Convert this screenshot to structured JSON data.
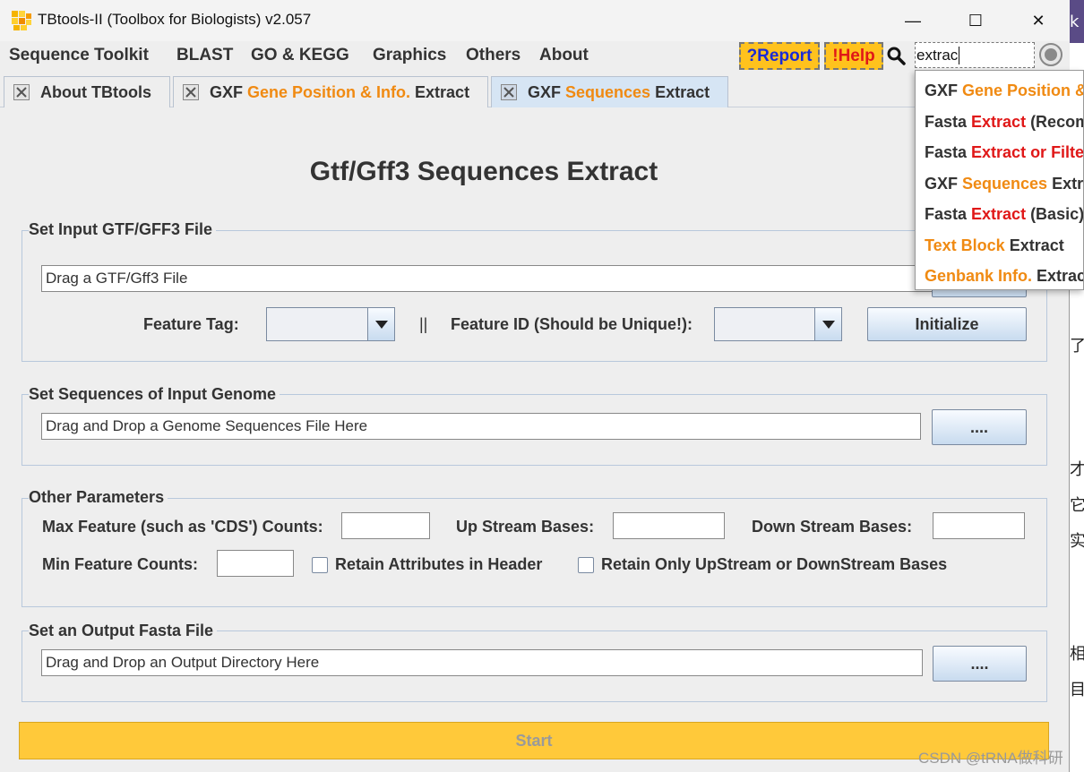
{
  "window": {
    "title": "TBtools-II (Toolbox for Biologists) v2.057",
    "minimize": "—",
    "maximize": "☐",
    "close": "✕"
  },
  "menu": {
    "items": [
      "Sequence Toolkit",
      "BLAST",
      "GO & KEGG",
      "Graphics",
      "Others",
      "About"
    ],
    "report_label": "?Report",
    "help_label": "!Help",
    "search_value": "extrac"
  },
  "tabs": [
    {
      "label_plain": "About TBtools"
    },
    {
      "label_a": "GXF ",
      "label_b": "Gene Position & Info.",
      "label_c": " Extract"
    },
    {
      "label_a": "GXF ",
      "label_b": "Sequences",
      "label_c": " Extract"
    }
  ],
  "dropdown": [
    {
      "a": "GXF ",
      "b": "Gene Position &",
      "c": ""
    },
    {
      "a": "Fasta ",
      "b": "Extract",
      "c": " (Recom"
    },
    {
      "a": "Fasta ",
      "b": "Extract or Filte",
      "c": ""
    },
    {
      "a": "GXF ",
      "b": "Sequences",
      "c": " Extr"
    },
    {
      "a": "Fasta ",
      "b": "Extract",
      "c": " (Basic)"
    },
    {
      "a": "",
      "b": "Text Block",
      "c": " Extract"
    },
    {
      "a": "",
      "b": "Genbank Info.",
      "c": " Extrac"
    }
  ],
  "page": {
    "title": "Gtf/Gff3 Sequences Extract",
    "input_group": {
      "title": "Set Input GTF/GFF3 File",
      "field_value": "Drag a GTF/Gff3 File",
      "feature_tag_label": "Feature Tag:",
      "separator": "||",
      "feature_id_label": "Feature ID (Should be Unique!):",
      "initialize_label": "Initialize"
    },
    "genome_group": {
      "title": "Set Sequences of Input Genome",
      "field_value": "Drag and Drop a Genome Sequences File Here",
      "browse_label": "...."
    },
    "params_group": {
      "title": "Other Parameters",
      "max_feature_label": "Max Feature (such as 'CDS') Counts:",
      "upstream_label": "Up Stream Bases:",
      "downstream_label": "Down Stream Bases:",
      "min_feature_label": "Min Feature Counts:",
      "retain_attr_label": "Retain Attributes in Header",
      "retain_only_label": "Retain Only UpStream or DownStream Bases"
    },
    "output_group": {
      "title": "Set an Output Fasta File",
      "field_value": "Drag and Drop an Output Directory Here",
      "browse_label": "...."
    },
    "start_label": "Start"
  },
  "background_chars": [
    "k",
    "了",
    "才",
    "它",
    "实",
    "相",
    "目"
  ],
  "watermark": "CSDN @tRNA做科研"
}
